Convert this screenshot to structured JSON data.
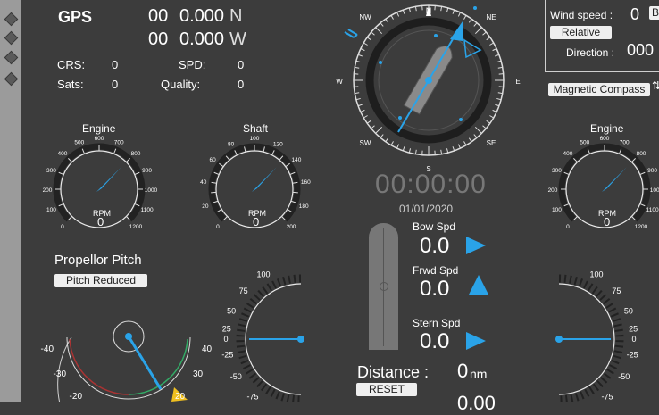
{
  "gps": {
    "title": "GPS",
    "lat_deg": "00",
    "lat_min": "0.000",
    "lat_hemi": "N",
    "lon_deg": "00",
    "lon_min": "0.000",
    "lon_hemi": "W",
    "crs_label": "CRS:",
    "crs_value": "0",
    "spd_label": "SPD:",
    "spd_value": "0",
    "sats_label": "Sats:",
    "sats_value": "0",
    "quality_label": "Quality:",
    "quality_value": "0"
  },
  "compass": {
    "n": "N",
    "ne": "NE",
    "e": "E",
    "se": "SE",
    "s": "S",
    "sw": "SW",
    "w": "W",
    "nw": "NW",
    "heading_deg": 30
  },
  "clock": {
    "time": "00:00:00",
    "date": "01/01/2020"
  },
  "wind": {
    "speed_label": "Wind speed :",
    "speed_value": "0",
    "unit_button": "B",
    "relative_button": "Relative",
    "direction_label": "Direction :",
    "direction_value": "000",
    "compass_button": "Magnetic Compass"
  },
  "gauges": {
    "engine_left": {
      "title": "Engine",
      "unit": "RPM",
      "value": "0",
      "ticks": [
        "0",
        "100",
        "200",
        "300",
        "400",
        "500",
        "600",
        "700",
        "800",
        "900",
        "1000",
        "1100",
        "1200"
      ]
    },
    "shaft": {
      "title": "Shaft",
      "unit": "RPM",
      "value": "0",
      "ticks": [
        "0",
        "10",
        "20",
        "30",
        "40",
        "50",
        "60",
        "70",
        "80",
        "90",
        "100",
        "110",
        "120",
        "130",
        "140",
        "150",
        "160",
        "170",
        "180",
        "190",
        "200"
      ]
    },
    "engine_right": {
      "title": "Engine",
      "unit": "RPM",
      "value": "0",
      "ticks": [
        "0",
        "100",
        "200",
        "300",
        "400",
        "500",
        "600",
        "700",
        "800",
        "900",
        "1000",
        "1100",
        "1200"
      ]
    }
  },
  "propeller": {
    "title": "Propellor Pitch",
    "status_button": "Pitch Reduced",
    "ticks_left": [
      "-40",
      "-30",
      "-20"
    ],
    "ticks_right": [
      "40",
      "30",
      "20"
    ]
  },
  "thrusters": {
    "bow_label": "Bow Spd",
    "bow_value": "0.0",
    "fwd_label": "Frwd Spd",
    "fwd_value": "0.0",
    "stern_label": "Stern Spd",
    "stern_value": "0.0"
  },
  "distance": {
    "label": "Distance :",
    "value": "0",
    "unit": "nm",
    "reset_button": "RESET",
    "second_value": "0.00"
  },
  "rudder_scale_left": [
    "100",
    "75",
    "50",
    "25",
    "0",
    "-25",
    "-50",
    "-75"
  ],
  "rudder_scale_right": [
    "100",
    "75",
    "50",
    "25",
    "0",
    "-25",
    "-50",
    "-75"
  ],
  "colors": {
    "accent": "#2aa3e8",
    "background": "#3c3c3c",
    "sidebar": "#9b9b9b",
    "warning": "#f0c020"
  }
}
